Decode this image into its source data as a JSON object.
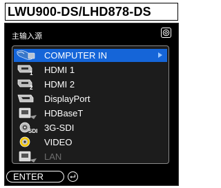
{
  "model": "LWU900-DS/LHD878-DS",
  "menu": {
    "header": "主输入源",
    "items": [
      {
        "label": "COMPUTER IN",
        "icon": "vga-connector-icon",
        "selected": true,
        "enabled": true
      },
      {
        "label": "HDMI 1",
        "icon": "hdmi-connector-icon",
        "badge": "1",
        "enabled": true
      },
      {
        "label": "HDMI 2",
        "icon": "hdmi-connector-icon",
        "badge": "2",
        "enabled": true
      },
      {
        "label": "DisplayPort",
        "icon": "displayport-connector-icon",
        "enabled": true
      },
      {
        "label": "HDBaseT",
        "icon": "lan-cable-connector-icon",
        "enabled": true
      },
      {
        "label": "3G-SDI",
        "icon": "bnc-connector-icon",
        "badge": "SDI",
        "enabled": true
      },
      {
        "label": "VIDEO",
        "icon": "rca-connector-icon",
        "enabled": true
      },
      {
        "label": "LAN",
        "icon": "lan-cable-connector-icon",
        "enabled": false
      }
    ]
  },
  "footer": {
    "enter_label": "ENTER",
    "enter_icon": "enter-icon"
  },
  "colors": {
    "selection": "#1565d8",
    "background": "#000000",
    "panel": "#1c1c1c",
    "disabled_text": "#6e6e6e"
  }
}
